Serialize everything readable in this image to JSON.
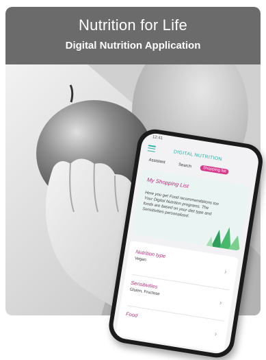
{
  "header": {
    "title": "Nutrition for Life",
    "subtitle": "Digital Nutrition Application"
  },
  "phone": {
    "status_time": "12:41",
    "app_title": "DIGITAL NUTRITION",
    "tabs": [
      "Assistant",
      "Search",
      "Shopping list"
    ],
    "active_tab": "Shopping list",
    "shopping_card": {
      "title": "My Shopping List",
      "description": "Here you get Food recommendations too Your Digital Nutrition programs. The foods are based on your diet type and Sensitivities personalized."
    },
    "items": [
      {
        "label": "Nutrition type",
        "value": "Vegan"
      },
      {
        "label": "Sensitivities",
        "value": "Gluten, Fructose"
      },
      {
        "label": "Food",
        "value": ""
      }
    ],
    "accent_color": "#2bb3a6",
    "highlight_color": "#d63a8c"
  },
  "colors": {
    "header_bg": "#6b6b6b",
    "header_text": "#ffffff"
  },
  "icons": [
    "hamburger-menu-icon",
    "chevron-right-icon"
  ]
}
